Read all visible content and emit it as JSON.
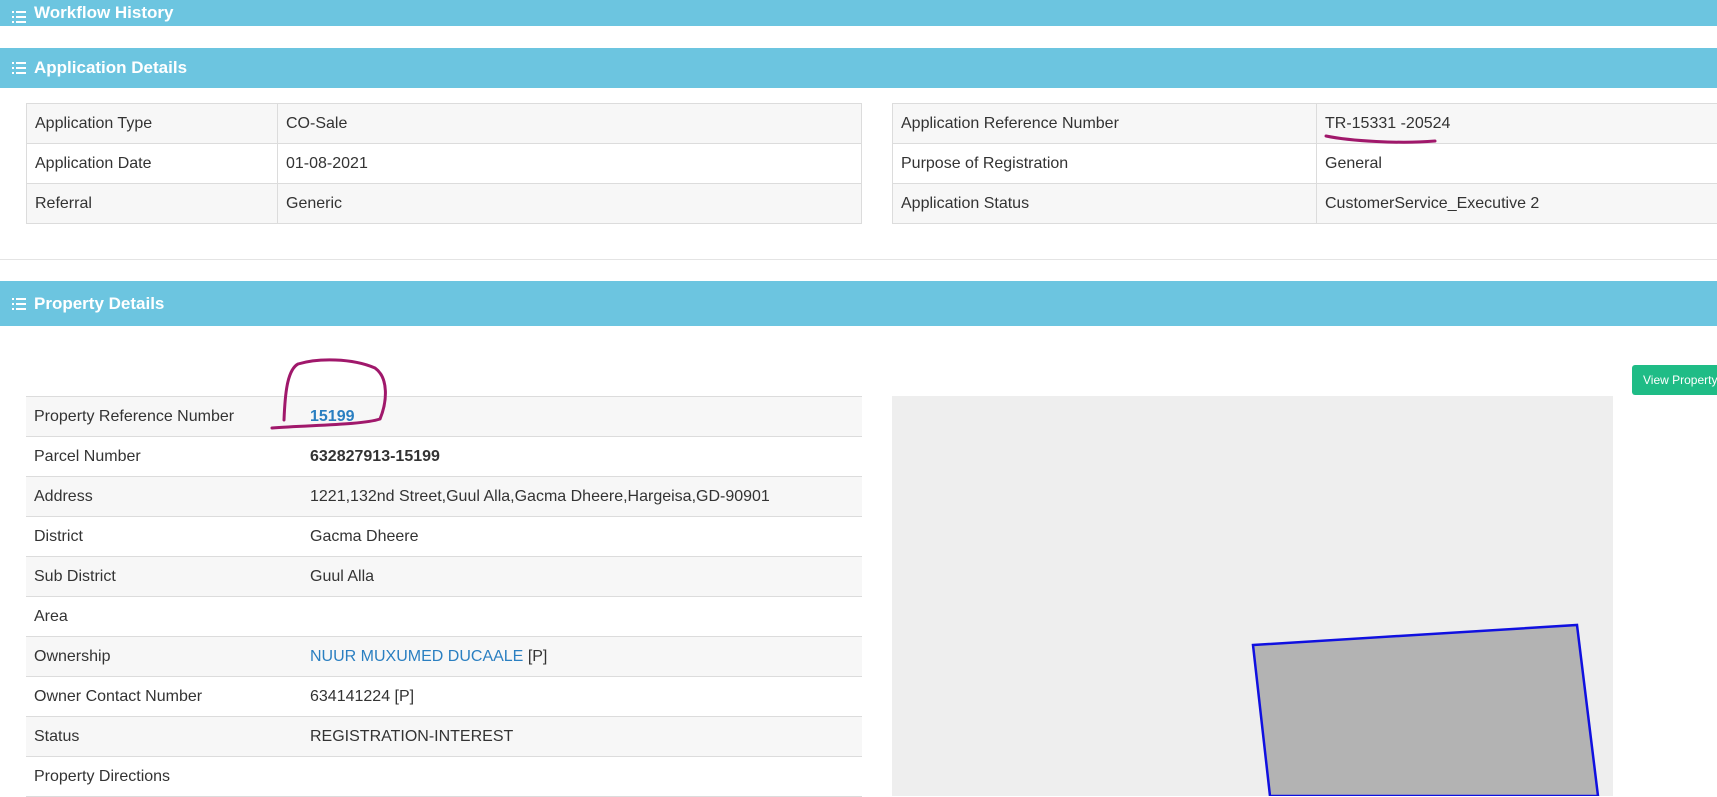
{
  "sections": {
    "workflow_history": "Workflow History",
    "application_details": "Application Details",
    "property_details": "Property Details"
  },
  "application_left": [
    {
      "label": "Application Type",
      "value": "CO-Sale"
    },
    {
      "label": "Application Date",
      "value": "01-08-2021"
    },
    {
      "label": "Referral",
      "value": "Generic"
    }
  ],
  "application_right": [
    {
      "label": "Application Reference Number",
      "value": "TR-15331 -20524"
    },
    {
      "label": "Purpose of Registration",
      "value": "General"
    },
    {
      "label": "Application Status",
      "value": "CustomerService_Executive 2"
    }
  ],
  "property": {
    "view_property_button": "View Property",
    "rows": [
      {
        "label": "Property Reference Number",
        "value": "15199"
      },
      {
        "label": "Parcel Number",
        "value": "632827913-15199"
      },
      {
        "label": "Address",
        "value": "1221,132nd Street,Guul Alla,Gacma Dheere,Hargeisa,GD-90901"
      },
      {
        "label": "District",
        "value": "Gacma Dheere"
      },
      {
        "label": "Sub District",
        "value": "Guul Alla"
      },
      {
        "label": "Area",
        "value": ""
      },
      {
        "label": "Ownership",
        "value": "NUUR MUXUMED DUCAALE",
        "suffix": "[P]"
      },
      {
        "label": "Owner Contact Number",
        "value": "634141224 [P]"
      },
      {
        "label": "Status",
        "value": "REGISTRATION-INTEREST"
      },
      {
        "label": "Property Directions",
        "value": ""
      }
    ]
  },
  "colors": {
    "header_bg": "#6cc5e0",
    "button_bg": "#1fbc86",
    "link": "#2a7fc1",
    "annotation": "#a0186b",
    "parcel_outline": "#1010e0",
    "parcel_fill": "#b3b3b3"
  }
}
